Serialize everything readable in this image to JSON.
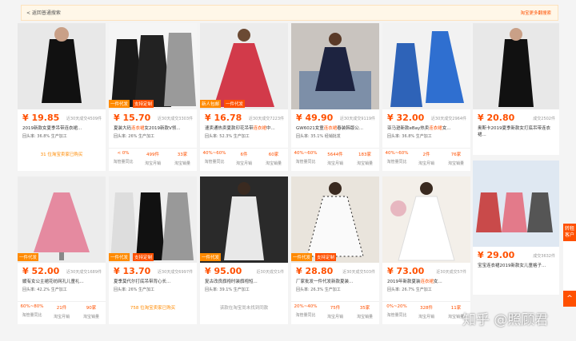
{
  "topbar": {
    "back_label": "< 返回普通搜索",
    "right_label": "淘宝更多翻搜索"
  },
  "products": [
    {
      "price": "¥ 19.85",
      "sold": "近30天成交4509件",
      "title_pre": "2019新款女夏季",
      "title_hl": "",
      "title_post": "吊带连衣裙...",
      "meta": "回头率: 36.8%  生产加工",
      "tags": [],
      "stats": [],
      "note": "31 位淘宝卖家已购买"
    },
    {
      "price": "¥ 15.70",
      "sold": "近30天成交3303件",
      "title_pre": "夏装大码",
      "title_hl": "连衣裙",
      "title_post": "女2019新款V领...",
      "meta": "回头率: 26%  生产加工",
      "tags": [
        "一件代发",
        "支持定制"
      ],
      "stats": [
        {
          "v": "< 0%",
          "l": "淘管量同比"
        },
        {
          "v": "499件",
          "l": "淘宝月销"
        },
        {
          "v": "33家",
          "l": "淘宝销量"
        }
      ],
      "note": ""
    },
    {
      "price": "¥ 16.78",
      "sold": "近30天成交7223件",
      "title_pre": "速卖通热卖夏款印花吊带",
      "title_hl": "连衣裙",
      "title_post": "中...",
      "meta": "回头率: 52.3%  生产加工",
      "tags": [
        "新人包邮",
        "一件代发"
      ],
      "stats": [
        {
          "v": "40%~60%",
          "l": "淘管量同比"
        },
        {
          "v": "6件",
          "l": "淘宝月销"
        },
        {
          "v": "60家",
          "l": "淘宝销量"
        }
      ],
      "note": ""
    },
    {
      "price": "¥ 49.90",
      "sold": "近30天成交9119件",
      "title_pre": "GW6021女童",
      "title_hl": "连衣裙",
      "title_post": "春装韩版公...",
      "meta": "回头率: 35.1%  经销批发",
      "tags": [],
      "stats": [
        {
          "v": "40%~60%",
          "l": "淘管量同比"
        },
        {
          "v": "5644件",
          "l": "淘宝月销"
        },
        {
          "v": "183家",
          "l": "淘宝销量"
        }
      ],
      "note": ""
    },
    {
      "price": "¥ 32.00",
      "sold": "近30天成交2964件",
      "title_pre": "亚马逊新款eBay热卖",
      "title_hl": "连衣裙",
      "title_post": "女...",
      "meta": "回头率: 36.8%  生产加工",
      "tags": [],
      "stats": [
        {
          "v": "40%~60%",
          "l": "淘管量同比"
        },
        {
          "v": "2件",
          "l": "淘宝月销"
        },
        {
          "v": "76家",
          "l": "淘宝销量"
        }
      ],
      "note": ""
    },
    {
      "price": "¥ 52.00",
      "sold": "近30天成交1689件",
      "title_pre": "媛有女公主裙花纺网孔儿童礼...",
      "title_hl": "",
      "title_post": "",
      "meta": "回头率: 42.2%  生产加工",
      "tags": [
        "一件代发"
      ],
      "stats": [
        {
          "v": "60%~80%",
          "l": "淘管量同比"
        },
        {
          "v": "21件",
          "l": "淘宝月销"
        },
        {
          "v": "90家",
          "l": "淘宝销量"
        }
      ],
      "note": ""
    },
    {
      "price": "¥ 13.70",
      "sold": "近30天成交6997件",
      "title_pre": "夏季莫代尔打底吊带背心长...",
      "title_hl": "",
      "title_post": "",
      "meta": "回头率: 26%  生产加工",
      "tags": [
        "一件代发",
        "支持定制"
      ],
      "stats": [],
      "note": "758 位淘宝卖家已购买"
    },
    {
      "price": "¥ 95.00",
      "sold": "近30天成交1件",
      "title_pre": "复古改良旗袍时装旗袍短...",
      "title_hl": "",
      "title_post": "",
      "meta": "回头率: 39.1%  生产加工",
      "tags": [
        "一件代发"
      ],
      "stats": [],
      "note": "该款在淘宝尚未找到同款"
    },
    {
      "price": "¥ 28.80",
      "sold": "近30天成交503件",
      "title_pre": "厂家批发一件代发新款夏装...",
      "title_hl": "",
      "title_post": "",
      "meta": "回头率: 26.3%  生产加工",
      "tags": [
        "一件代发",
        "支持定制"
      ],
      "stats": [
        {
          "v": "20%~40%",
          "l": "淘管量同比"
        },
        {
          "v": "75件",
          "l": "淘宝月销"
        },
        {
          "v": "35家",
          "l": "淘宝销量"
        }
      ],
      "note": ""
    },
    {
      "price": "¥ 73.00",
      "sold": "近30天成交57件",
      "title_pre": "2019年新款夏装",
      "title_hl": "连衣裙",
      "title_post": "女...",
      "meta": "回头率: 26.7%  生产加工",
      "tags": [],
      "stats": [
        {
          "v": "0%~20%",
          "l": "淘管量同比"
        },
        {
          "v": "328件",
          "l": "淘宝月销"
        },
        {
          "v": "11家",
          "l": "淘宝销量"
        }
      ],
      "note": ""
    }
  ],
  "side": [
    {
      "price": "¥ 20.80",
      "sold": "成交2502件",
      "title": "奥斯卡2019夏季新款女打底吊带连衣裙..."
    },
    {
      "price": "¥ 29.00",
      "sold": "成交3632件",
      "title": "宝宝连衣裙2019新款女儿童格子..."
    }
  ],
  "float": {
    "top_label": "转租客户",
    "bottom_label": "^"
  },
  "watermark": "知乎 @照顾君"
}
